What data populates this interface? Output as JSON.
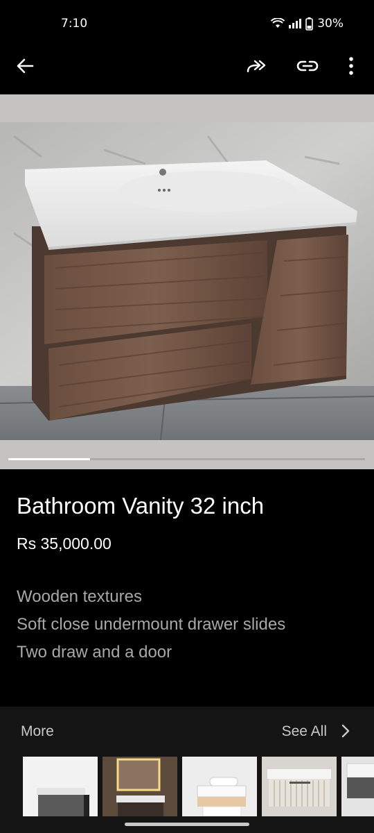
{
  "status_bar": {
    "time": "7:10",
    "battery": "30%",
    "icons": [
      "wifi-icon",
      "signal-icon",
      "battery-icon"
    ]
  },
  "app_bar": {
    "icons": [
      "back-arrow-icon",
      "share-icon",
      "link-icon",
      "more-vert-icon"
    ]
  },
  "gallery": {
    "image": "bathroom-vanity-photo",
    "progress": 0.23
  },
  "product": {
    "title": "Bathroom Vanity 32 inch",
    "price": "Rs 35,000.00",
    "description": [
      "Wooden textures",
      "Soft close undermount drawer slides",
      "Two draw and a door"
    ]
  },
  "more": {
    "label": "More",
    "see_all": "See All",
    "thumbnails": [
      "vanity-grey-thumbnail",
      "vanity-mirror-thumbnail",
      "vanity-white-thumbnail",
      "vanity-ribbed-thumbnail",
      "vanity-partial-thumbnail"
    ]
  },
  "colors": {
    "background": "#000000",
    "text_primary": "#ffffff",
    "text_secondary": "#a8a8a8",
    "section_bg": "#141414"
  }
}
